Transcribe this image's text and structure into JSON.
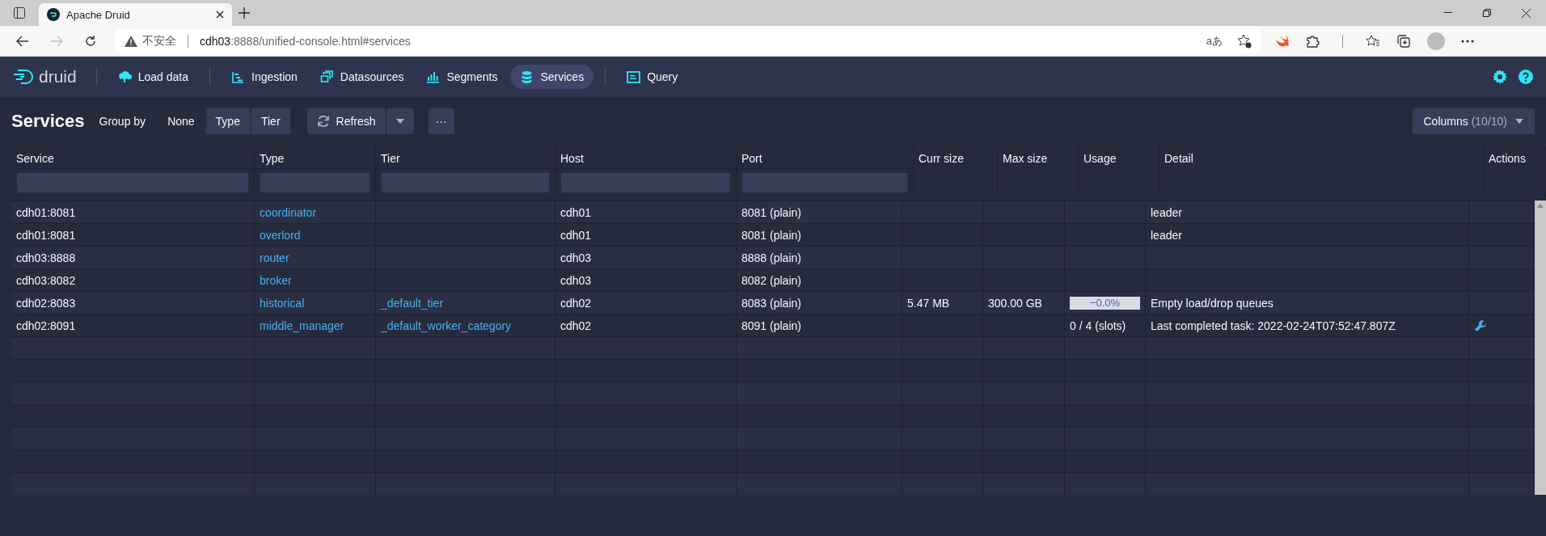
{
  "browser": {
    "tab_title": "Apache Druid",
    "security": "不安全",
    "url_host": "cdh03",
    "url_rest": ":8888/unified-console.html#services",
    "translate_label": "aあ"
  },
  "nav": {
    "logo": "druid",
    "items": [
      {
        "label": "Load data",
        "selected": false
      },
      {
        "label": "Ingestion",
        "selected": false
      },
      {
        "label": "Datasources",
        "selected": false
      },
      {
        "label": "Segments",
        "selected": false
      },
      {
        "label": "Services",
        "selected": true
      },
      {
        "label": "Query",
        "selected": false
      }
    ]
  },
  "toolbar": {
    "title": "Services",
    "group_by_label": "Group by",
    "group_by": [
      {
        "label": "None",
        "selected": true
      },
      {
        "label": "Type",
        "selected": false
      },
      {
        "label": "Tier",
        "selected": false
      }
    ],
    "refresh": "Refresh",
    "more": "···",
    "columns_label": "Columns",
    "columns_count": "(10/10)"
  },
  "table": {
    "columns": [
      {
        "label": "Service"
      },
      {
        "label": "Type"
      },
      {
        "label": "Tier"
      },
      {
        "label": "Host"
      },
      {
        "label": "Port"
      },
      {
        "label": "Curr size"
      },
      {
        "label": "Max size"
      },
      {
        "label": "Usage"
      },
      {
        "label": "Detail"
      },
      {
        "label": "Actions"
      }
    ],
    "rows": [
      {
        "service": "cdh01:8081",
        "type": "coordinator",
        "host": "cdh01",
        "port": "8081 (plain)",
        "detail": "leader",
        "action": false
      },
      {
        "service": "cdh01:8081",
        "type": "overlord",
        "host": "cdh01",
        "port": "8081 (plain)",
        "detail": "leader",
        "action": false
      },
      {
        "service": "cdh03:8888",
        "type": "router",
        "host": "cdh03",
        "port": "8888 (plain)",
        "action": false
      },
      {
        "service": "cdh03:8082",
        "type": "broker",
        "host": "cdh03",
        "port": "8082 (plain)",
        "action": false
      },
      {
        "service": "cdh02:8083",
        "type": "historical",
        "tier": "_default_tier",
        "host": "cdh02",
        "port": "8083 (plain)",
        "curr_size": "5.47 MB",
        "max_size": "300.00 GB",
        "usage": {
          "kind": "bar",
          "level": 0,
          "reading": "−0.0%"
        },
        "detail": "Empty load/drop queues",
        "action": false
      },
      {
        "service": "cdh02:8091",
        "type": "middle_manager",
        "tier": "_default_worker_category",
        "host": "cdh02",
        "port": "8091 (plain)",
        "usage": {
          "kind": "text",
          "text": "0 / 4 (slots)"
        },
        "detail": "Last completed task: 2022-02-24T07:52:47.807Z",
        "action": true
      }
    ]
  }
}
